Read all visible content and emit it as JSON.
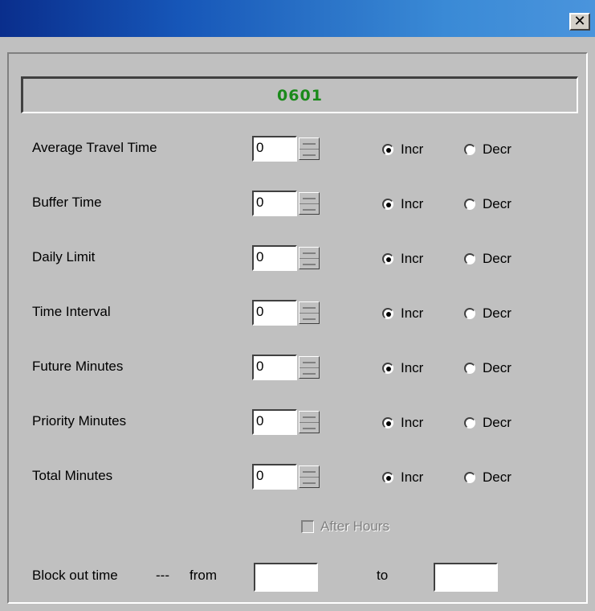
{
  "window": {
    "close_glyph": "✕"
  },
  "header": {
    "title": "0601"
  },
  "rows": [
    {
      "label": "Average Travel Time",
      "value": "0",
      "incr_label": "Incr",
      "decr_label": "Decr",
      "selected": "incr"
    },
    {
      "label": "Buffer Time",
      "value": "0",
      "incr_label": "Incr",
      "decr_label": "Decr",
      "selected": "incr"
    },
    {
      "label": "Daily Limit",
      "value": "0",
      "incr_label": "Incr",
      "decr_label": "Decr",
      "selected": "incr"
    },
    {
      "label": "Time Interval",
      "value": "0",
      "incr_label": "Incr",
      "decr_label": "Decr",
      "selected": "incr"
    },
    {
      "label": "Future Minutes",
      "value": "0",
      "incr_label": "Incr",
      "decr_label": "Decr",
      "selected": "incr"
    },
    {
      "label": "Priority Minutes",
      "value": "0",
      "incr_label": "Incr",
      "decr_label": "Decr",
      "selected": "incr"
    },
    {
      "label": "Total Minutes",
      "value": "0",
      "incr_label": "Incr",
      "decr_label": "Decr",
      "selected": "incr"
    }
  ],
  "after_hours": {
    "label": "After Hours",
    "checked": false,
    "disabled": true
  },
  "block_out": {
    "label": "Block out time",
    "separator": "---",
    "from_label": "from",
    "to_label": "to",
    "from_value": "",
    "to_value": ""
  },
  "colors": {
    "header_text": "#1a8a1a",
    "dialog_bg": "#c0c0c0"
  }
}
